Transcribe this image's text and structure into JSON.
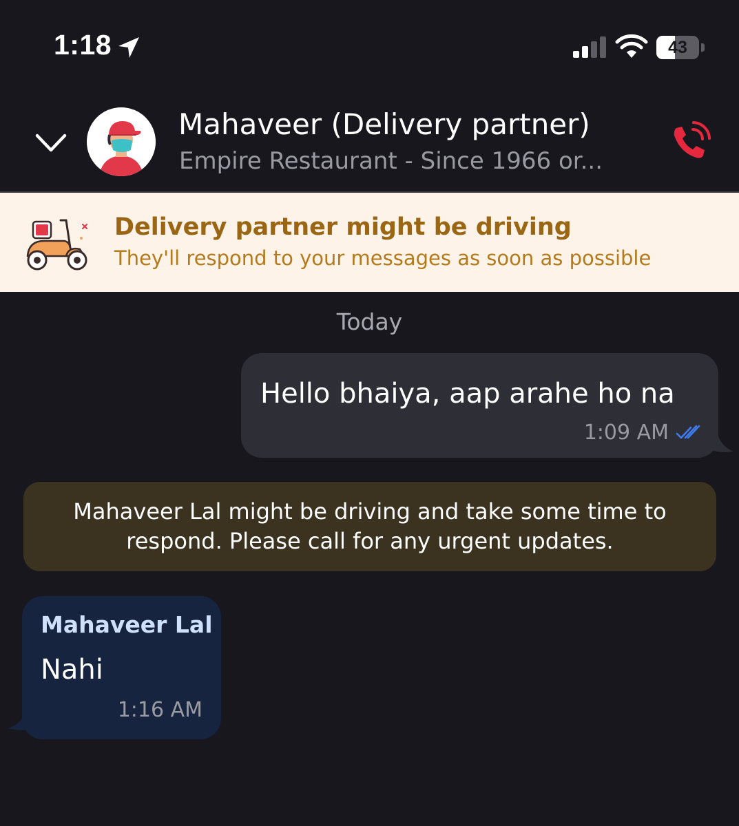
{
  "status_bar": {
    "time": "1:18",
    "battery_percent": 43,
    "battery_label": "43",
    "icons": [
      "location-arrow-icon",
      "signal-icon",
      "wifi-icon",
      "battery-icon"
    ]
  },
  "header": {
    "contact_name": "Mahaveer (Delivery partner)",
    "contact_subtitle": "Empire Restaurant - Since 1966 or...",
    "icons": [
      "chevron-down-icon",
      "delivery-avatar",
      "phone-call-icon"
    ],
    "call_icon_color": "#e5283d"
  },
  "banner": {
    "title": "Delivery partner might be driving",
    "subtitle": "They'll respond to your messages as soon as possible",
    "background_color": "#fdf3e8",
    "title_color": "#9a6614",
    "icon": "scooter-icon"
  },
  "chat": {
    "date_separator": "Today",
    "messages": [
      {
        "direction": "outgoing",
        "text": "Hello bhaiya, aap arahe ho na",
        "time": "1:09 AM",
        "status_icon": "double-check-icon",
        "bubble_color": "#2e2e36"
      },
      {
        "direction": "system",
        "text": "Mahaveer Lal might be driving and take some time to respond. Please call for any urgent updates.",
        "bubble_color": "#3b3320"
      },
      {
        "direction": "incoming",
        "sender": "Mahaveer Lal",
        "text": "Nahi",
        "time": "1:16 AM",
        "bubble_color": "#17243f"
      }
    ]
  }
}
